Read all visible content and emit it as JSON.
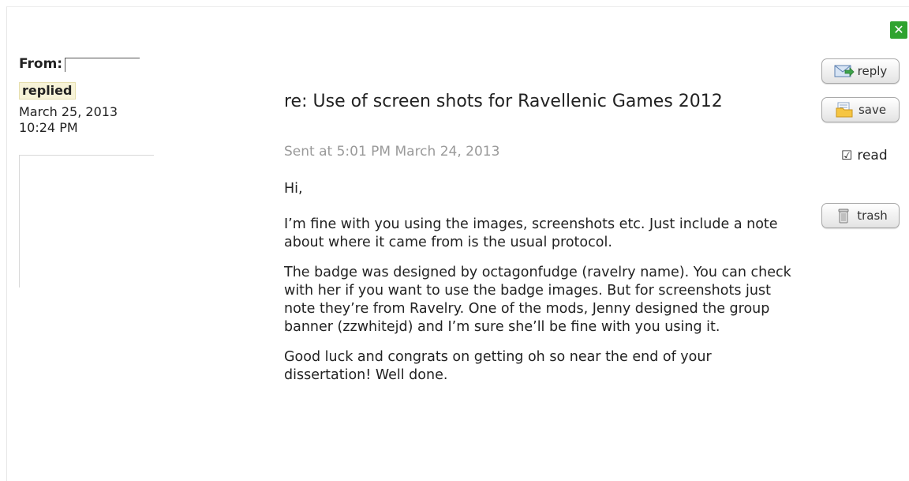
{
  "window": {
    "close_label": "✕"
  },
  "sender": {
    "from_label": "From:",
    "from_value": "",
    "status_badge": "replied",
    "reply_date": "March 25, 2013",
    "reply_time": "10:24 PM"
  },
  "message": {
    "subject": "re: Use of screen shots for Ravellenic Games 2012",
    "sent_meta": "Sent at 5:01 PM March 24, 2013",
    "greeting": "Hi,",
    "paragraphs": [
      "I’m fine with you using the images, screenshots etc. Just include a note about where it came from is the usual protocol.",
      "The badge was designed by octagonfudge (ravelry name). You can check with her if you want to use the badge images. But for screenshots just note they’re from Ravelry. One of the mods, Jenny designed the group banner (zzwhitejd) and I’m sure she’ll be fine with you using it.",
      "Good luck and congrats on getting oh so near the end of your dissertation! Well done."
    ]
  },
  "actions": {
    "reply_label": "reply",
    "save_label": "save",
    "read_label": "read",
    "read_checked": true,
    "read_check_glyph": "☑",
    "trash_label": "trash"
  },
  "colors": {
    "close_green": "#2fa32f",
    "badge_bg": "#f7f3d8",
    "meta_gray": "#9a9a9a"
  },
  "icons": {
    "reply": "envelope-arrow-icon",
    "save": "folder-save-icon",
    "trash": "trash-can-icon",
    "close": "close-icon"
  }
}
